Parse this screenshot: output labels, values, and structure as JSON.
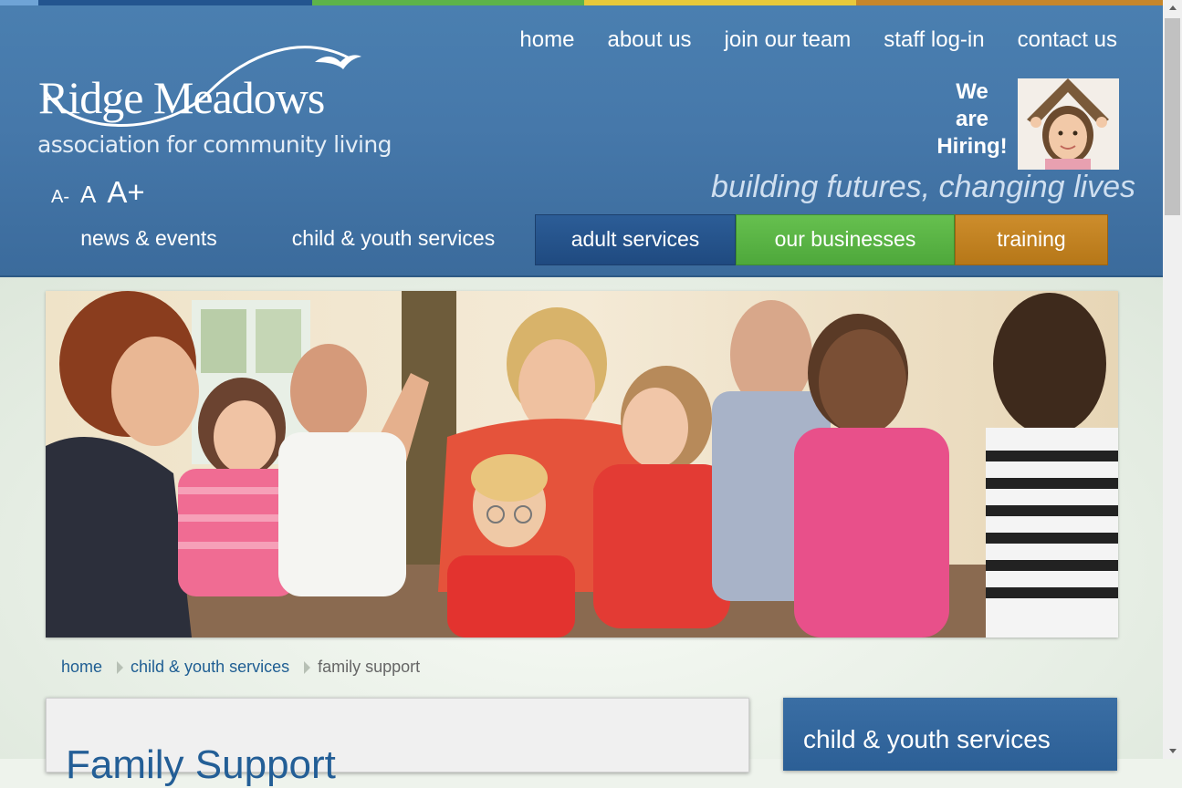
{
  "brand": {
    "name": "Ridge Meadows",
    "subtitle": "association for community living",
    "tagline": "building futures, changing lives"
  },
  "topnav": [
    {
      "label": "home"
    },
    {
      "label": "about us"
    },
    {
      "label": "join our team"
    },
    {
      "label": "staff log-in"
    },
    {
      "label": "contact us"
    }
  ],
  "hiring": {
    "line1": "We",
    "line2": "are",
    "line3": "Hiring!"
  },
  "font_sizer": {
    "small": "A-",
    "normal": "A",
    "large": "A+"
  },
  "mainnav": [
    {
      "label": "news & events"
    },
    {
      "label": "child & youth services"
    },
    {
      "label": "adult services",
      "color": "#23558f"
    },
    {
      "label": "our businesses",
      "color": "#5db34a"
    },
    {
      "label": "training",
      "color": "#c6862a"
    }
  ],
  "breadcrumb": {
    "home": "home",
    "section": "child & youth services",
    "current": "family support"
  },
  "content": {
    "title": "Family Support"
  },
  "sidebar": {
    "title": "child & youth services"
  },
  "colors": {
    "header_blue": "#4678aa",
    "link_blue": "#1f5e93"
  }
}
